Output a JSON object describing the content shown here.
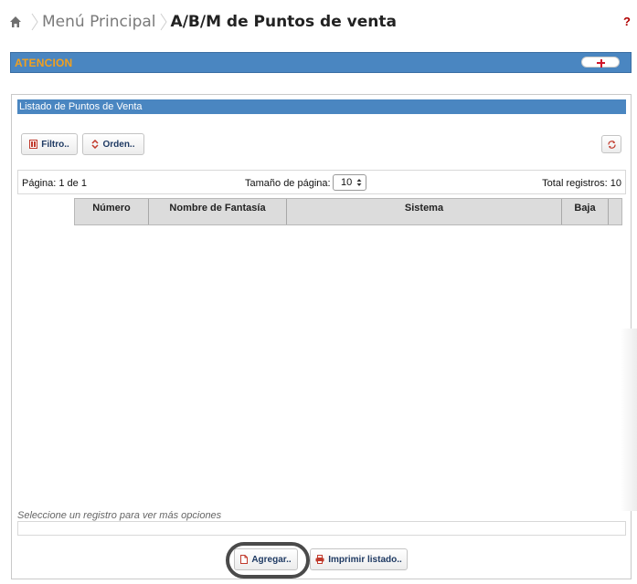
{
  "breadcrumb": {
    "home_icon": "home-icon",
    "parent": "Menú Principal",
    "current": "A/B/M de Puntos de venta",
    "help": "?"
  },
  "attention": {
    "label": "ATENCION",
    "expand_icon": "plus-icon"
  },
  "panel": {
    "title": "Listado de Puntos de Venta",
    "toolbar": {
      "filter_label": "Filtro..",
      "order_label": "Orden..",
      "refresh_icon": "refresh-icon"
    },
    "pager": {
      "page_text": "Página: 1 de 1",
      "page_size_label": "Tamaño de página:",
      "page_size_value": "10",
      "total_text": "Total registros: 10"
    },
    "columns": [
      "Número",
      "Nombre de Fantasía",
      "Sistema",
      "Baja"
    ],
    "status_hint": "Seleccione un registro para ver más opciones",
    "actions": {
      "add_label": "Agregar..",
      "print_label": "Imprimir listado.."
    }
  },
  "colors": {
    "header_blue": "#4a86c1",
    "attention_orange": "#f0a020",
    "button_text": "#1f3a63",
    "icon_red": "#d0152a"
  }
}
